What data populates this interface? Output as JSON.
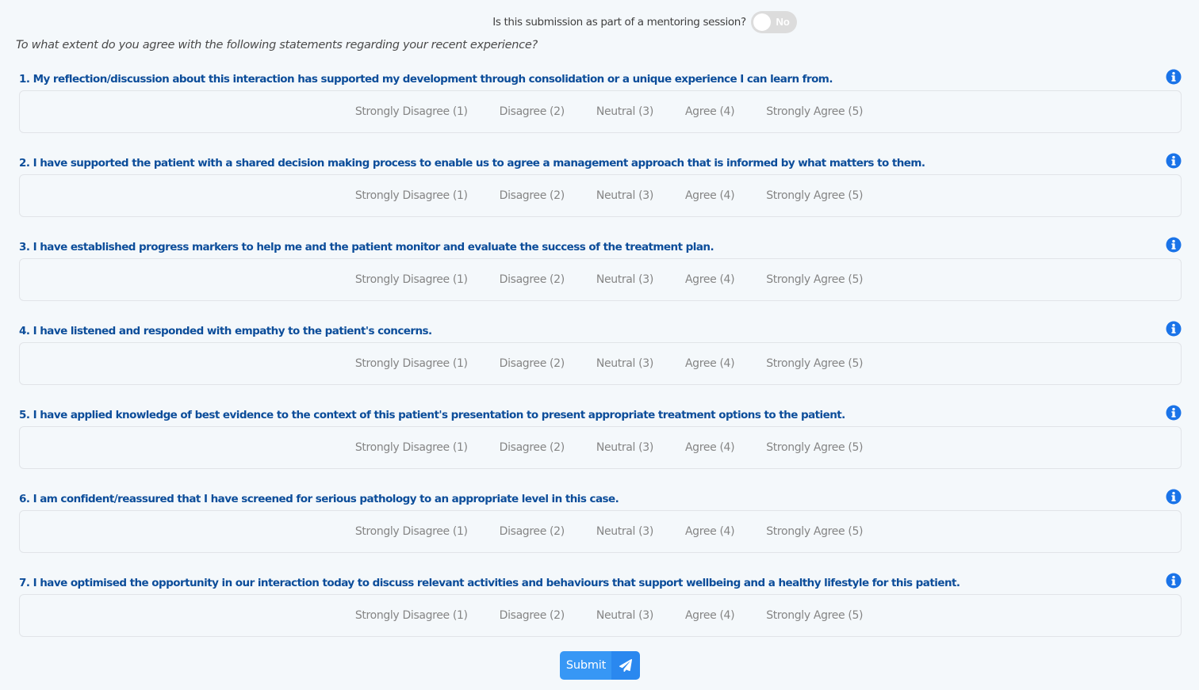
{
  "mentoring": {
    "question": "Is this submission as part of a mentoring session?",
    "toggle_state": "No",
    "toggle_on": false
  },
  "intro": "To what extent do you agree with the following statements regarding your recent experience?",
  "scale_options": [
    "Strongly Disagree (1)",
    "Disagree (2)",
    "Neutral (3)",
    "Agree (4)",
    "Strongly Agree (5)"
  ],
  "questions": [
    {
      "label": "1. My reflection/discussion about this interaction has supported my development through consolidation or a unique experience I can learn from.",
      "icon": "info-icon"
    },
    {
      "label": "2. I have supported the patient with a shared decision making process to enable us to agree a management approach that is informed by what matters to them.",
      "icon": "info-icon"
    },
    {
      "label": "3. I have established progress markers to help me and the patient monitor and evaluate the success of the treatment plan.",
      "icon": "info-icon"
    },
    {
      "label": "4. I have listened and responded with empathy to the patient's concerns.",
      "icon": "info-icon"
    },
    {
      "label": "5. I have applied knowledge of best evidence to the context of this patient's presentation to present appropriate treatment options to the patient.",
      "icon": "info-icon"
    },
    {
      "label": "6. I am confident/reassured that I have screened for serious pathology to an appropriate level in this case.",
      "icon": "info-icon"
    },
    {
      "label": "7. I have optimised the opportunity in our interaction today to discuss relevant activities and behaviours that support wellbeing and a healthy lifestyle for this patient.",
      "icon": "info-icon"
    }
  ],
  "submit": {
    "label": "Submit",
    "icon": "paper-plane-icon"
  },
  "colors": {
    "background": "#f4f8fb",
    "question_text": "#0c4d9a",
    "info_icon": "#1a73e8",
    "submit_primary": "#3797f5",
    "submit_icon_bg": "#2a88ef",
    "toggle_off": "#dcdcdc",
    "scale_text": "#858585"
  }
}
